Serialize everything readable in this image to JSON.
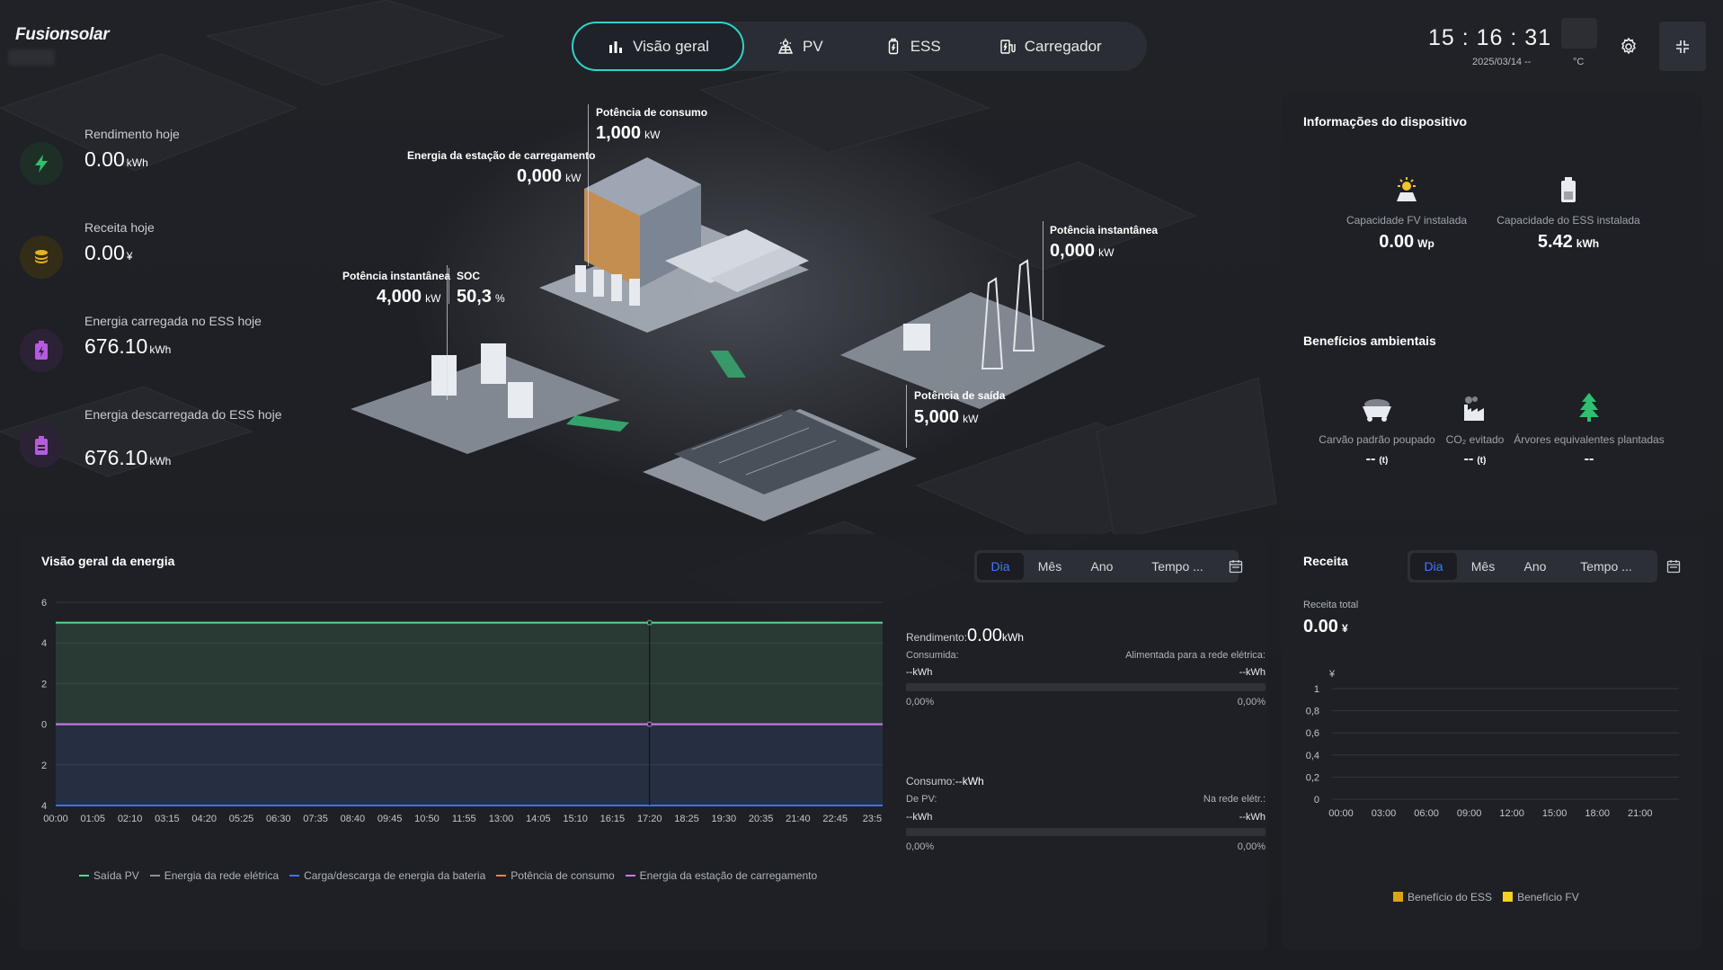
{
  "brand": {
    "logo": "Fusionsolar"
  },
  "tabs": [
    {
      "label": "Visão geral",
      "icon": "bar-chart-icon"
    },
    {
      "label": "PV",
      "icon": "solar-panel-icon"
    },
    {
      "label": "ESS",
      "icon": "battery-icon"
    },
    {
      "label": "Carregador",
      "icon": "charger-icon"
    }
  ],
  "header": {
    "time": "15 : 16 : 31",
    "date": "2025/03/14 --",
    "temp_unit": "°C"
  },
  "stats": [
    {
      "label": "Rendimento hoje",
      "value": "0.00",
      "unit": "kWh",
      "icon": "lightning-icon"
    },
    {
      "label": "Receita hoje",
      "value": "0.00",
      "unit": "¥",
      "icon": "coins-icon"
    },
    {
      "label": "Energia carregada no ESS hoje",
      "value": "676.10",
      "unit": "kWh",
      "icon": "battery-charge-icon"
    },
    {
      "label": "Energia descarregada do ESS hoje",
      "value": "676.10",
      "unit": "kWh",
      "icon": "battery-discharge-icon"
    }
  ],
  "scene": {
    "consumption": {
      "label": "Potência de consumo",
      "value": "1,000",
      "unit": "kW"
    },
    "charging_station": {
      "label": "Energia da estação de carregamento",
      "value": "0,000",
      "unit": "kW"
    },
    "ess_power": {
      "label": "Potência instantânea",
      "value": "4,000",
      "unit": "kW"
    },
    "soc": {
      "label": "SOC",
      "value": "50,3",
      "unit": "%"
    },
    "grid_power": {
      "label": "Potência instantânea",
      "value": "0,000",
      "unit": "kW"
    },
    "output": {
      "label": "Potência de saída",
      "value": "5,000",
      "unit": "kW"
    }
  },
  "device_info": {
    "title": "Informações do dispositivo",
    "items": [
      {
        "label": "Capacidade FV instalada",
        "value": "0.00",
        "unit": "Wp"
      },
      {
        "label": "Capacidade do ESS instalada",
        "value": "5.42",
        "unit": "kWh"
      }
    ]
  },
  "env": {
    "title": "Benefícios ambientais",
    "items": [
      {
        "label": "Carvão padrão poupado",
        "value": "--",
        "unit": "(t)"
      },
      {
        "label": "CO₂ evitado",
        "value": "--",
        "unit": "(t)"
      },
      {
        "label": "Árvores equivalentes plantadas",
        "value": "--",
        "unit": ""
      }
    ]
  },
  "energy": {
    "title": "Visão geral da energia",
    "periods": [
      "Dia",
      "Mês",
      "Ano",
      "Tempo ..."
    ],
    "yield_label": "Rendimento:",
    "yield_value": "0.00",
    "yield_unit": "kWh",
    "consumed_label": "Consumida:",
    "fed_label": "Alimentada para a rede elétrica:",
    "consumed_value": "--kWh",
    "fed_value": "--kWh",
    "consumed_pct": "0,00%",
    "fed_pct": "0,00%",
    "consumption_label": "Consumo:",
    "consumption_value": "--kWh",
    "from_pv_label": "De PV:",
    "from_grid_label": "Na rede elétr.:",
    "from_pv_value": "--kWh",
    "from_grid_value": "--kWh",
    "from_pv_pct": "0,00%",
    "from_grid_pct": "0,00%"
  },
  "revenue": {
    "title": "Receita",
    "periods": [
      "Dia",
      "Mês",
      "Ano",
      "Tempo ..."
    ],
    "total_label": "Receita total",
    "total_value": "0.00",
    "total_unit": "¥"
  },
  "chart_data": [
    {
      "type": "line",
      "x": [
        "00:00",
        "01:05",
        "02:10",
        "03:15",
        "04:20",
        "05:25",
        "06:30",
        "07:35",
        "08:40",
        "09:45",
        "10:50",
        "11:55",
        "13:00",
        "14:05",
        "15:10",
        "16:15",
        "17:20",
        "18:25",
        "19:30",
        "20:35",
        "21:40",
        "22:45",
        "23:5"
      ],
      "ytick_labels": [
        "6",
        "4",
        "2",
        "0",
        "2",
        "4"
      ],
      "series": [
        {
          "name": "Saída PV",
          "color": "#5ed38f",
          "values": [
            5,
            5,
            5,
            5,
            5,
            5,
            5,
            5,
            5,
            5,
            5,
            5,
            5,
            5,
            5,
            5,
            5,
            5,
            5,
            5,
            5,
            5,
            5
          ]
        },
        {
          "name": "Energia da rede elétrica",
          "color": "#8c8f96",
          "values": [
            0,
            0,
            0,
            0,
            0,
            0,
            0,
            0,
            0,
            0,
            0,
            0,
            0,
            0,
            0,
            0,
            0,
            0,
            0,
            0,
            0,
            0,
            0
          ]
        },
        {
          "name": "Carga/descarga de energia da bateria",
          "color": "#3d74e6",
          "values": [
            -4,
            -4,
            -4,
            -4,
            -4,
            -4,
            -4,
            -4,
            -4,
            -4,
            -4,
            -4,
            -4,
            -4,
            -4,
            -4,
            -4,
            -4,
            -4,
            -4,
            -4,
            -4,
            -4
          ]
        },
        {
          "name": "Potência de consumo",
          "color": "#e8892b",
          "values": []
        },
        {
          "name": "Energia da estação de carregamento",
          "color": "#c77ae6",
          "values": [
            0,
            0,
            0,
            0,
            0,
            0,
            0,
            0,
            0,
            0,
            0,
            0,
            0,
            0,
            0,
            0,
            0,
            0,
            0,
            0,
            0,
            0,
            0
          ]
        }
      ],
      "ylim": [
        -4,
        6
      ],
      "grid": true,
      "legend": "bottom"
    },
    {
      "type": "bar",
      "categories": [
        "00:00",
        "03:00",
        "06:00",
        "09:00",
        "12:00",
        "15:00",
        "18:00",
        "21:00"
      ],
      "ylabel": "¥",
      "yticks": [
        "0",
        "0,2",
        "0,4",
        "0,6",
        "0,8",
        "1"
      ],
      "ylim": [
        0,
        1
      ],
      "series": [
        {
          "name": "Benefício do ESS",
          "color": "#e0a21a",
          "values": []
        },
        {
          "name": "Benefício FV",
          "color": "#f5cf2a",
          "values": []
        }
      ],
      "legend": "bottom"
    }
  ]
}
